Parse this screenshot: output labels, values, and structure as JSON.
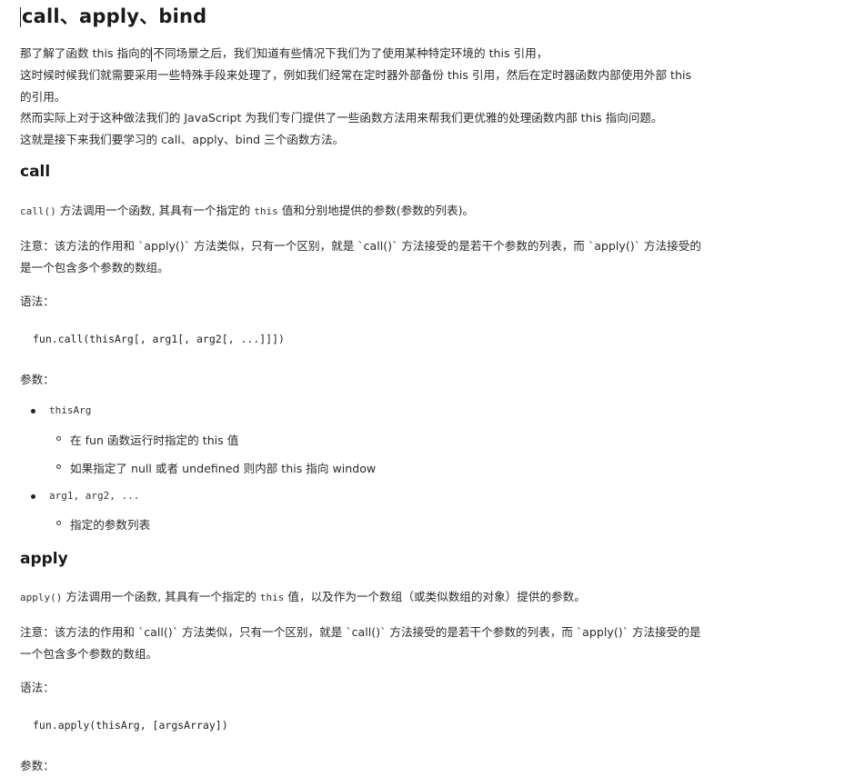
{
  "title": "call、apply、bind",
  "intro": {
    "line1a": "那了解了函数 this 指向的",
    "line1b": "不同场景之后，我们知道有些情况下我们为了使用某种特定环境的 this 引用，",
    "line2": "这时候时候我们就需要采用一些特殊手段来处理了，例如我们经常在定时器外部备份 this 引用，然后在定时器函数内部使用外部 this",
    "line3": "的引用。",
    "line4": "然而实际上对于这种做法我们的 JavaScript 为我们专门提供了一些函数方法用来帮我们更优雅的处理函数内部 this 指向问题。",
    "line5": "这就是接下来我们要学习的 call、apply、bind 三个函数方法。"
  },
  "call": {
    "heading": "call",
    "desc_code": "call()",
    "desc_mid": " 方法调用一个函数, 其具有一个指定的 ",
    "desc_this": "this",
    "desc_end": " 值和分别地提供的参数(参数的列表)。",
    "note1": "注意：该方法的作用和 `apply()` 方法类似，只有一个区别，就是 `call()` 方法接受的是若干个参数的列表，而 `apply()` 方法接受的",
    "note2": "是一个包含多个参数的数组。",
    "syntax_label": "语法：",
    "syntax": "fun.call(thisArg[, arg1[, arg2[, ...]]])",
    "params_label": "参数：",
    "params": [
      {
        "name": "thisArg",
        "subs": [
          "在 fun 函数运行时指定的 this 值",
          "如果指定了 null 或者 undefined 则内部 this 指向 window"
        ]
      },
      {
        "name": "arg1, arg2, ...",
        "subs": [
          "指定的参数列表"
        ]
      }
    ]
  },
  "apply": {
    "heading": "apply",
    "desc_code": "apply()",
    "desc_mid": " 方法调用一个函数, 其具有一个指定的 ",
    "desc_this": "this",
    "desc_end": " 值，以及作为一个数组（或类似数组的对象）提供的参数。",
    "note1": "注意：该方法的作用和 `call()` 方法类似，只有一个区别，就是 `call()` 方法接受的是若干个参数的列表，而 `apply()` 方法接受的是",
    "note2": "一个包含多个参数的数组。",
    "syntax_label": "语法：",
    "syntax": "fun.apply(thisArg, [argsArray])",
    "params_label": "参数："
  }
}
